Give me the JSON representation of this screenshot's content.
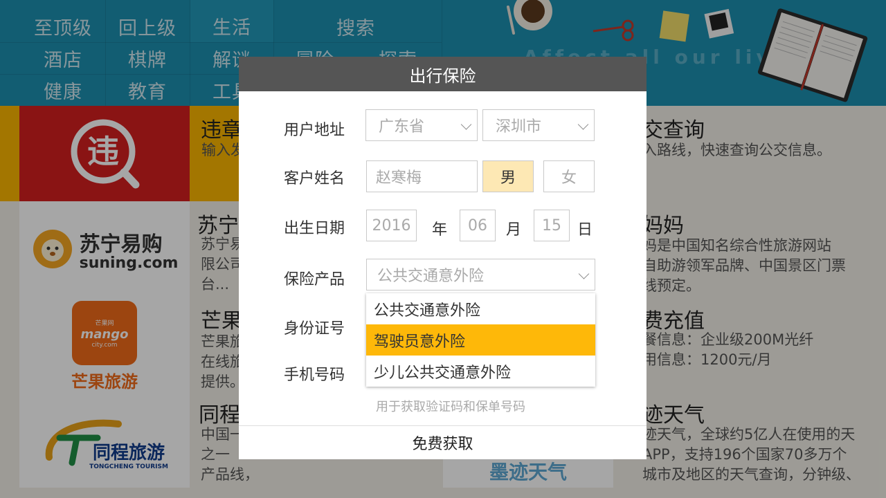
{
  "nav": {
    "row1": [
      "至顶级",
      "回上级",
      "生活",
      "搜索"
    ],
    "row2": [
      "酒店",
      "棋牌",
      "解谜",
      "冒险",
      "探索"
    ],
    "row3": [
      "健康",
      "教育",
      "工具"
    ],
    "banner_text": "Affect all our lives"
  },
  "cards": [
    {
      "logo_text": "违",
      "title": "违章",
      "desc": "输入发"
    },
    {
      "logo_text": "苏宁易购",
      "logo_sub": "suning.com",
      "title": "苏宁",
      "desc": "苏宁易\n限公司\n台..."
    },
    {
      "logo_text": "芒果旅游",
      "logo_sub": "mango",
      "logo_sub2": "芒果网",
      "logo_sub3": "city.com",
      "title": "芒果",
      "desc": "芒果旅\n在线旅\n提供。"
    },
    {
      "logo_text": "同程旅游",
      "logo_sub": "TONGCHENG TOURISM",
      "title": "同程",
      "desc": "中国一\n之一\n产品线，"
    }
  ],
  "right_cards": [
    {
      "title": "交查询",
      "desc": "入路线，快速查询公交信息。"
    },
    {
      "title": "妈妈",
      "desc": "妈是中国知名综合性旅游网站\n自助游领军品牌、中国景区门票\n线预定。"
    },
    {
      "title": "费充值",
      "desc": "餐信息：企业级200M光纤\n用信息：1200元/月"
    },
    {
      "title": "迹天气",
      "desc": "迹天气，全球约5亿人在使用的天\nAPP，支持196个国家70多万个\n城市及地区的天气查询，分钟级、"
    }
  ],
  "bottom_logo": "墨迹天气",
  "dialog": {
    "title": "出行保险",
    "fields": {
      "address_label": "用户地址",
      "province": "广东省",
      "city": "深圳市",
      "name_label": "客户姓名",
      "name_placeholder": "赵寒梅",
      "gender_male": "男",
      "gender_female": "女",
      "birth_label": "出生日期",
      "year": "2016",
      "year_unit": "年",
      "month": "06",
      "month_unit": "月",
      "day": "15",
      "day_unit": "日",
      "product_label": "保险产品",
      "product_value": "公共交通意外险",
      "id_label": "身份证号",
      "phone_label": "手机号码",
      "hint": "用于获取验证码和保单号码"
    },
    "dropdown_options": [
      "公共交通意外险",
      "驾驶员意外险",
      "少儿公共交通意外险"
    ],
    "dropdown_active_index": 1,
    "submit": "免费获取"
  },
  "colors": {
    "nav_bg": "#1d8fb0",
    "accent": "#feb809",
    "selected_gender": "#fde8b4",
    "dialog_header": "#555555"
  }
}
